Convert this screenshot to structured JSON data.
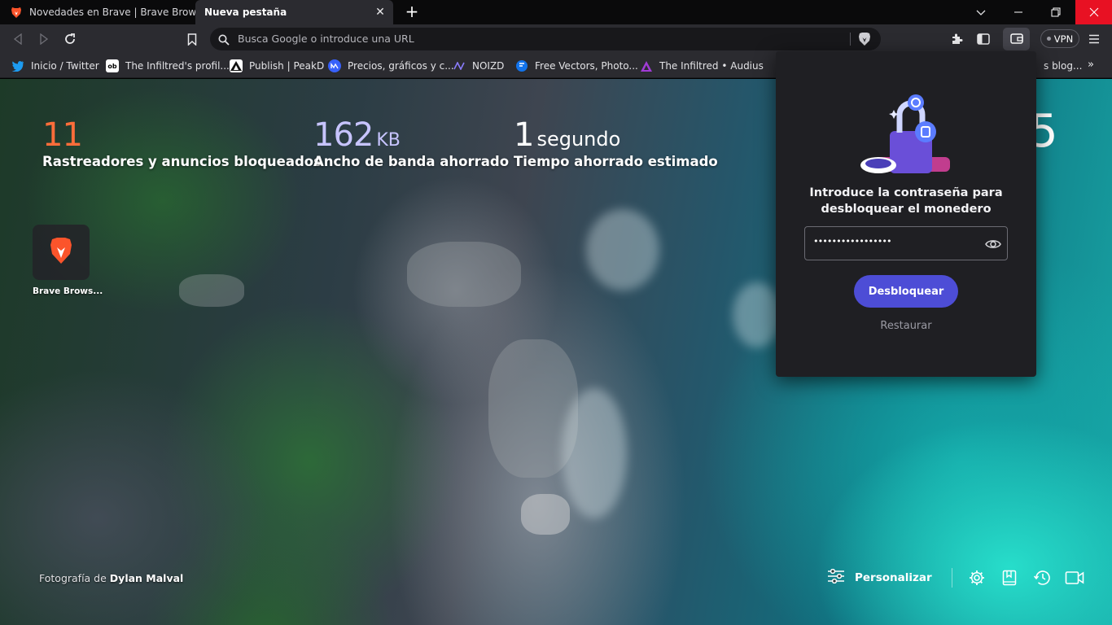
{
  "tabs": [
    {
      "title": "Novedades en Brave | Brave Browser",
      "active": false
    },
    {
      "title": "Nueva pestaña",
      "active": true
    }
  ],
  "omnibox": {
    "placeholder": "Busca Google o introduce una URL"
  },
  "toolbar": {
    "vpn_label": "VPN"
  },
  "bookmarks": [
    {
      "label": "Inicio / Twitter",
      "icon": "twitter-icon"
    },
    {
      "label": "The Infiltred's profil...",
      "icon": "objkt-icon"
    },
    {
      "label": "Publish | PeakD",
      "icon": "peakd-icon"
    },
    {
      "label": "Precios, gráficos y c...",
      "icon": "coinmarketcap-icon"
    },
    {
      "label": "NOIZD",
      "icon": "noizd-icon"
    },
    {
      "label": "Free Vectors, Photo...",
      "icon": "freepik-icon"
    },
    {
      "label": "The Infiltred • Audius",
      "icon": "audius-icon"
    },
    {
      "label": "s blog...",
      "icon": "blog-icon"
    }
  ],
  "stats": {
    "trackers": {
      "value": "11",
      "label": "Rastreadores y anuncios bloqueados"
    },
    "bandwidth": {
      "value": "162",
      "unit": "KB",
      "label": "Ancho de banda ahorrado"
    },
    "time": {
      "value": "1",
      "unit": "segundo",
      "label": "Tiempo ahorrado estimado"
    }
  },
  "clock_fragment": "5",
  "top_sites": [
    {
      "label": "Brave Brows..."
    }
  ],
  "photo_credit": {
    "prefix": "Fotografía de",
    "author": "Dylan Malval"
  },
  "footer": {
    "customize_label": "Personalizar"
  },
  "wallet": {
    "title": "Introduce la contraseña para desbloquear el monedero",
    "password_value": "•••••••••••••••••",
    "unlock_label": "Desbloquear",
    "restore_label": "Restaurar"
  },
  "colors": {
    "accent": "#4d4dd6",
    "trackers": "#ff6d3a",
    "bandwidth": "#c7c4ff",
    "close_button": "#e81123"
  }
}
